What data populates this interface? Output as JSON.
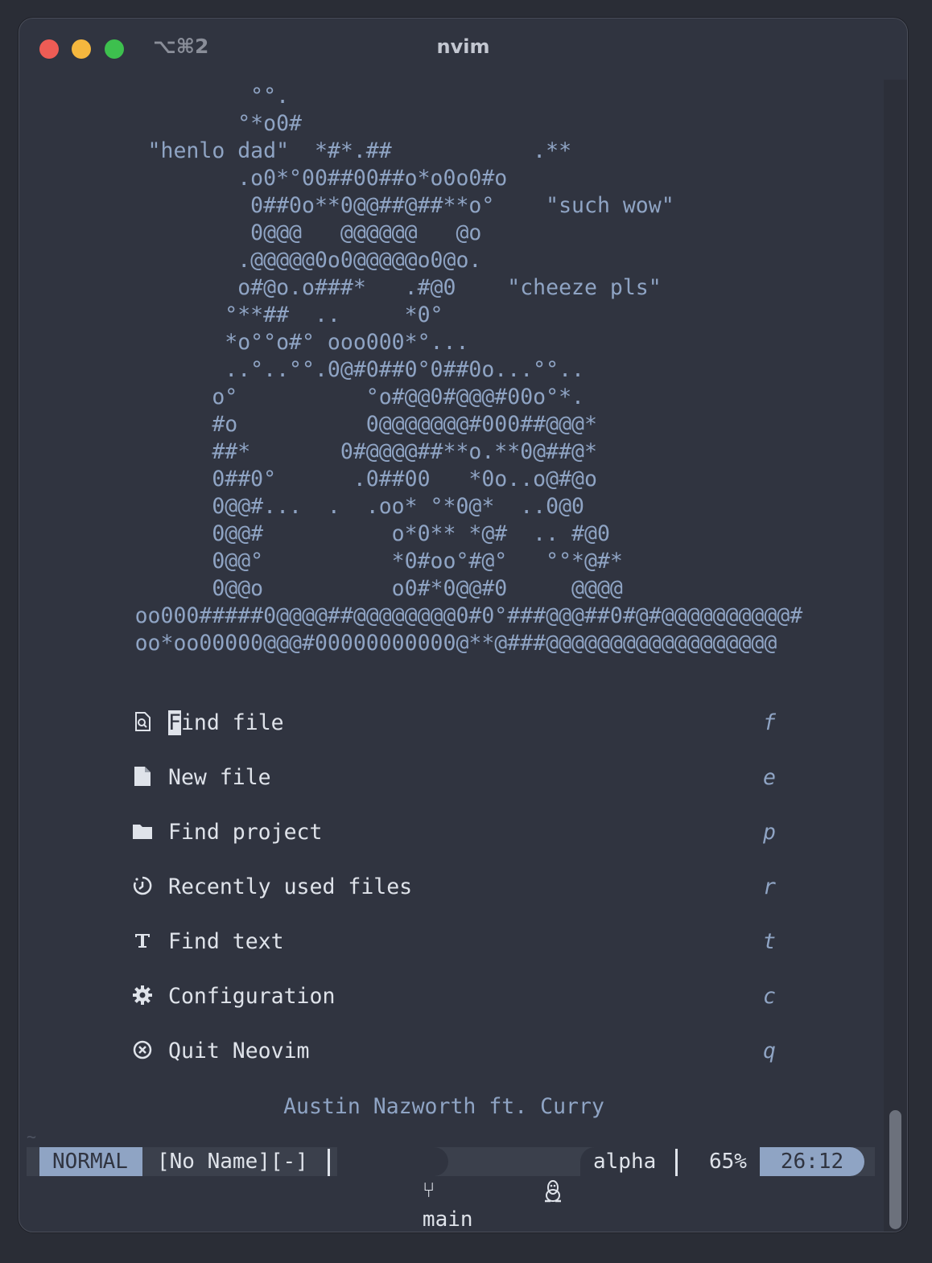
{
  "window": {
    "title": "nvim",
    "shortcut": "⌥⌘2"
  },
  "art": {
    "lines": [
      "              °°.",
      "             °*o0#",
      "      \"henlo dad\"  *#*.##           .**",
      "             .o0*°00##00##o*o0o0#o",
      "              0##0o**0@@##@##**o°    \"such wow\"",
      "              0@@@   @@@@@@   @o",
      "             .@@@@@0o0@@@@@o0@o.",
      "             o#@o.o###*   .#@0    \"cheeze pls\"",
      "            °**##  ..     *0°",
      "            *o°°o#° ooo000*°...",
      "            ..°..°°.0@#0##0°0##0o...°°..",
      "           o°          °o#@@0#@@@#00o°*.",
      "           #o          0@@@@@@@#000##@@@*",
      "           ##*       0#@@@@##**o.**0@##@*",
      "           0##0°      .0##00   *0o..o@#@o",
      "           0@@#...  .  .oo* °*0@*  ..0@0",
      "           0@@#          o*0** *@#  .. #@0",
      "           0@@°          *0#oo°#@°   °°*@#*",
      "           0@@o          o0#*0@@#0     @@@@",
      "     oo000#####0@@@@##@@@@@@@@0#0°###@@@##0#@#@@@@@@@@@@#",
      "     oo*oo00000@@@#00000000000@**@###@@@@@@@@@@@@@@@@@@"
    ]
  },
  "menu": [
    {
      "label": "Find file",
      "key": "f",
      "icon": "file-search-icon"
    },
    {
      "label": "New file",
      "key": "e",
      "icon": "new-file-icon"
    },
    {
      "label": "Find project",
      "key": "p",
      "icon": "folder-icon"
    },
    {
      "label": "Recently used files",
      "key": "r",
      "icon": "history-icon"
    },
    {
      "label": "Find text",
      "key": "t",
      "icon": "text-icon"
    },
    {
      "label": "Configuration",
      "key": "c",
      "icon": "gear-icon"
    },
    {
      "label": "Quit Neovim",
      "key": "q",
      "icon": "close-circle-icon"
    }
  ],
  "footer": "Austin Nazworth ft. Curry",
  "tilde": "~",
  "statusline": {
    "mode": "NORMAL",
    "file": "[No Name][-]",
    "branch": "main",
    "branch_icon": "git-branch-icon",
    "os_icon": "linux-tux-icon",
    "filetype": "alpha",
    "percent": "65%",
    "position": "26:12"
  },
  "colors": {
    "background": "#303440",
    "accent": "#8fa4c4",
    "text": "#dfe3ea"
  }
}
